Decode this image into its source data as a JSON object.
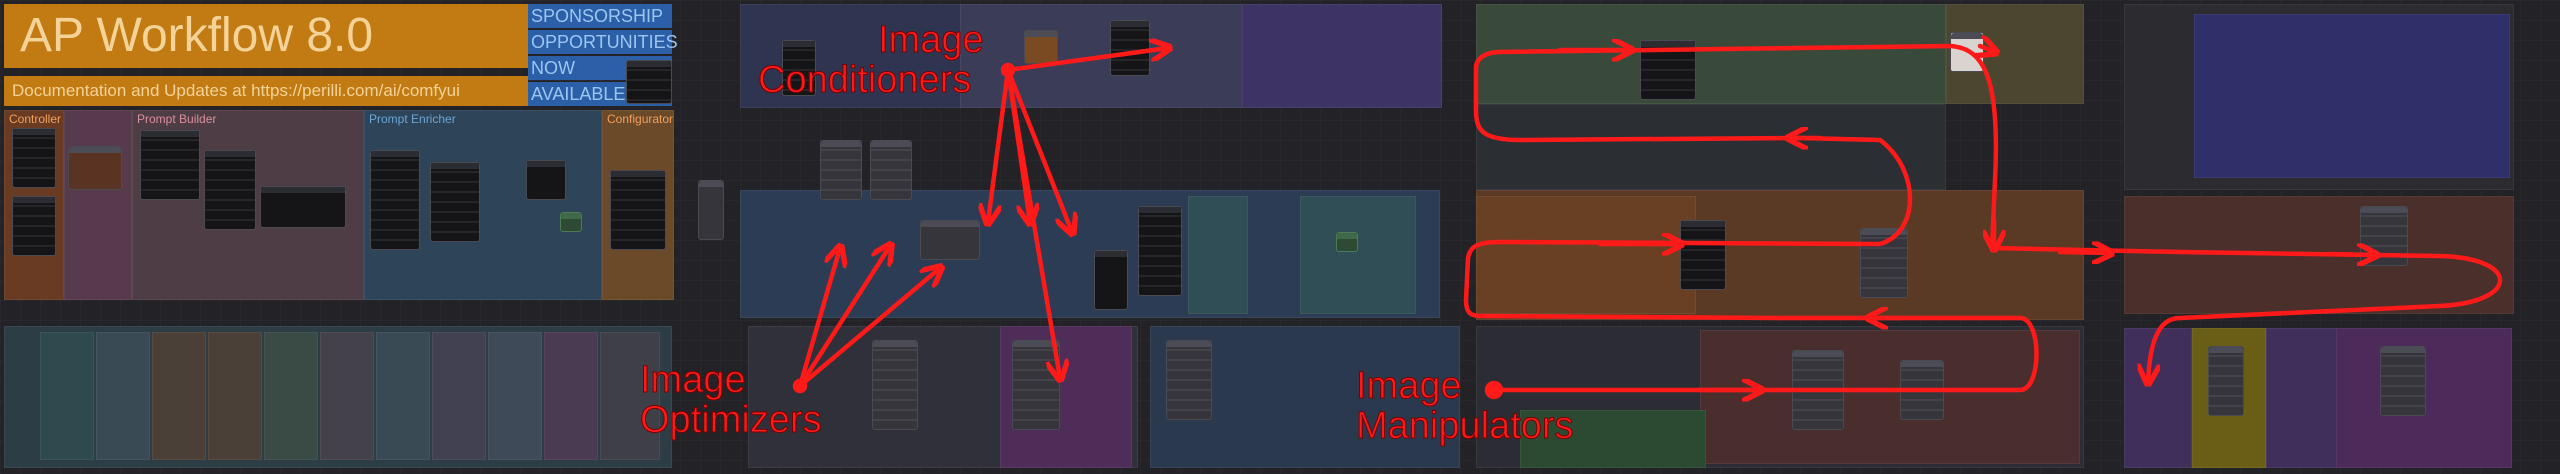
{
  "title": "AP Workflow 8.0",
  "documentation": "Documentation and Updates at https://perilli.com/ai/comfyui",
  "sponsorship": [
    "SPONSORSHIP",
    "OPPORTUNITIES",
    "NOW",
    "AVAILABLE"
  ],
  "groups": {
    "controller": "Controller",
    "prompt_builder": "Prompt Builder",
    "prompt_enricher": "Prompt Enricher",
    "configurator": "Configurator"
  },
  "annotations": {
    "image_conditioners": [
      "Image",
      "Conditioners"
    ],
    "image_optimizers": [
      "Image",
      "Optimizers"
    ],
    "image_manipulators": [
      "Image",
      "Manipulators"
    ]
  },
  "colors": {
    "banner_orange": "#c27a13",
    "banner_text": "#f4d398",
    "sponsor_blue": "#2b5fa8",
    "sponsor_text": "#9cc6f2",
    "annotation_red": "#ff1a1a"
  }
}
